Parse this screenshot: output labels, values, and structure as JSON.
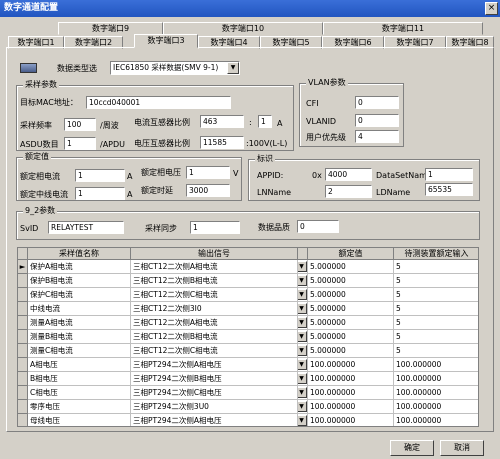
{
  "window": {
    "title": "数字通道配置",
    "close": "×"
  },
  "tabs_row1": [
    "数字端口9",
    "数字端口10",
    "数字端口11"
  ],
  "tabs_row2": [
    "数字端口1",
    "数字端口2",
    "数字端口3",
    "数字端口4",
    "数字端口5",
    "数字端口6",
    "数字端口7",
    "数字端口8"
  ],
  "data_type": {
    "label": "数据类型选",
    "value": "IEC61850 采样数据(SMV 9-1)"
  },
  "sample": {
    "title": "采样参数",
    "mac_label": "目标MAC地址：",
    "mac_value": "10ccd040001",
    "rate_label": "采样频率",
    "rate_value": "100",
    "rate_unit": "/周波",
    "ct_label": "电流互感器比例",
    "ct_value": "463",
    "ct_sep": ":",
    "ct_value2": "1",
    "ct_unit": "A",
    "asdu_label": "ASDU数目",
    "asdu_value": "1",
    "asdu_unit": "/APDU",
    "pt_label": "电压互感器比例",
    "pt_value": "11585",
    "pt_unit": ":100V(L-L)"
  },
  "vlan": {
    "title": "VLAN参数",
    "cfi_label": "CFI",
    "cfi_value": "0",
    "vlanid_label": "VLANID",
    "vlanid_value": "0",
    "prio_label": "用户优先级",
    "prio_value": "4"
  },
  "rated": {
    "title": "额定值",
    "phase_cur_label": "额定相电流",
    "phase_cur_value": "1",
    "phase_cur_unit": "A",
    "phase_volt_label": "额定相电压",
    "phase_volt_value": "1",
    "phase_volt_unit": "V",
    "neutral_label": "额定中线电流",
    "neutral_value": "1",
    "neutral_unit": "A",
    "delay_label": "额定时延",
    "delay_value": "3000"
  },
  "ident": {
    "title": "标识",
    "appid_label": "APPID:",
    "appid_prefix": "0x",
    "appid_value": "4000",
    "dsn_label": "DataSetName",
    "dsn_value": "1",
    "ldn_label": "LNName",
    "ldn_value": "2",
    "ldname_label": "LDName",
    "ldname_value": "65535"
  },
  "p92": {
    "title": "9_2参数",
    "svid_label": "SvID",
    "svid_value": "RELAYTEST",
    "sync_label": "采样同步",
    "sync_value": "1",
    "quality_label": "数据品质",
    "quality_value": "0"
  },
  "table": {
    "headers": [
      "",
      "采样值名称",
      "输出信号",
      "",
      "额定值",
      "待测装置额定输入"
    ],
    "rows": [
      {
        "name": "保护A相电流",
        "signal": "三相CT12二次侧A相电流",
        "rated": "5.000000",
        "input": "5"
      },
      {
        "name": "保护B相电流",
        "signal": "三相CT12二次侧B相电流",
        "rated": "5.000000",
        "input": "5"
      },
      {
        "name": "保护C相电流",
        "signal": "三相CT12二次侧C相电流",
        "rated": "5.000000",
        "input": "5"
      },
      {
        "name": "中线电流",
        "signal": "三相CT12二次侧3I0",
        "rated": "5.000000",
        "input": "5"
      },
      {
        "name": "测量A相电流",
        "signal": "三相CT12二次侧A相电流",
        "rated": "5.000000",
        "input": "5"
      },
      {
        "name": "测量B相电流",
        "signal": "三相CT12二次侧B相电流",
        "rated": "5.000000",
        "input": "5"
      },
      {
        "name": "测量C相电流",
        "signal": "三相CT12二次侧C相电流",
        "rated": "5.000000",
        "input": "5"
      },
      {
        "name": "A相电压",
        "signal": "三相PT294二次侧A相电压",
        "rated": "100.000000",
        "input": "100.000000"
      },
      {
        "name": "B相电压",
        "signal": "三相PT294二次侧B相电压",
        "rated": "100.000000",
        "input": "100.000000"
      },
      {
        "name": "C相电压",
        "signal": "三相PT294二次侧C相电压",
        "rated": "100.000000",
        "input": "100.000000"
      },
      {
        "name": "零序电压",
        "signal": "三相PT294二次侧3U0",
        "rated": "100.000000",
        "input": "100.000000"
      },
      {
        "name": "母线电压",
        "signal": "三相PT294二次侧A相电压",
        "rated": "100.000000",
        "input": "100.000000"
      }
    ]
  },
  "buttons": {
    "ok": "确定",
    "cancel": "取消"
  }
}
